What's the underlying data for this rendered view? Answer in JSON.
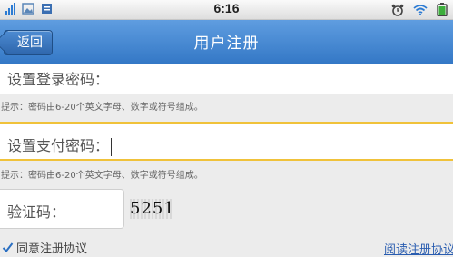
{
  "status_bar": {
    "time": "6:16"
  },
  "nav": {
    "back_label": "返回",
    "title": "用户注册"
  },
  "form": {
    "login_password": {
      "label": "设置登录密码：",
      "hint": "提示：密码由6-20个英文字母、数字或符号组成。"
    },
    "pay_password": {
      "label": "设置支付密码：",
      "hint": "提示：密码由6-20个英文字母、数字或符号组成。"
    },
    "captcha": {
      "label": "验证码：",
      "code": "5251"
    },
    "agree": {
      "label": "同意注册协议",
      "checked": true
    },
    "read_agreement_link": "阅读注册协议"
  },
  "colors": {
    "nav_blue": "#3a7fcc",
    "focus_border": "#f0c23a",
    "signal_blue": "#2c7bd3"
  }
}
